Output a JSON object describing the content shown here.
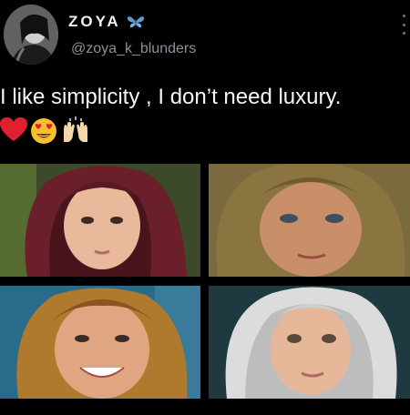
{
  "user": {
    "display_name": "ZOYA",
    "handle": "@zoya_k_blunders",
    "verified_badge_icon": "butterfly-icon"
  },
  "tweet": {
    "text": "I like simplicity , I don’t need luxury.",
    "emojis": [
      "red-heart",
      "heart-eyes-face",
      "raising-hands"
    ]
  },
  "media": {
    "photos": [
      {
        "name": "girl-maroon-scarf"
      },
      {
        "name": "girl-olive-scarf"
      },
      {
        "name": "girl-patterned-scarf"
      },
      {
        "name": "girl-white-scarf"
      }
    ]
  },
  "colors": {
    "background": "#000000",
    "text": "#f5f5f5",
    "handle": "#8b9198"
  }
}
